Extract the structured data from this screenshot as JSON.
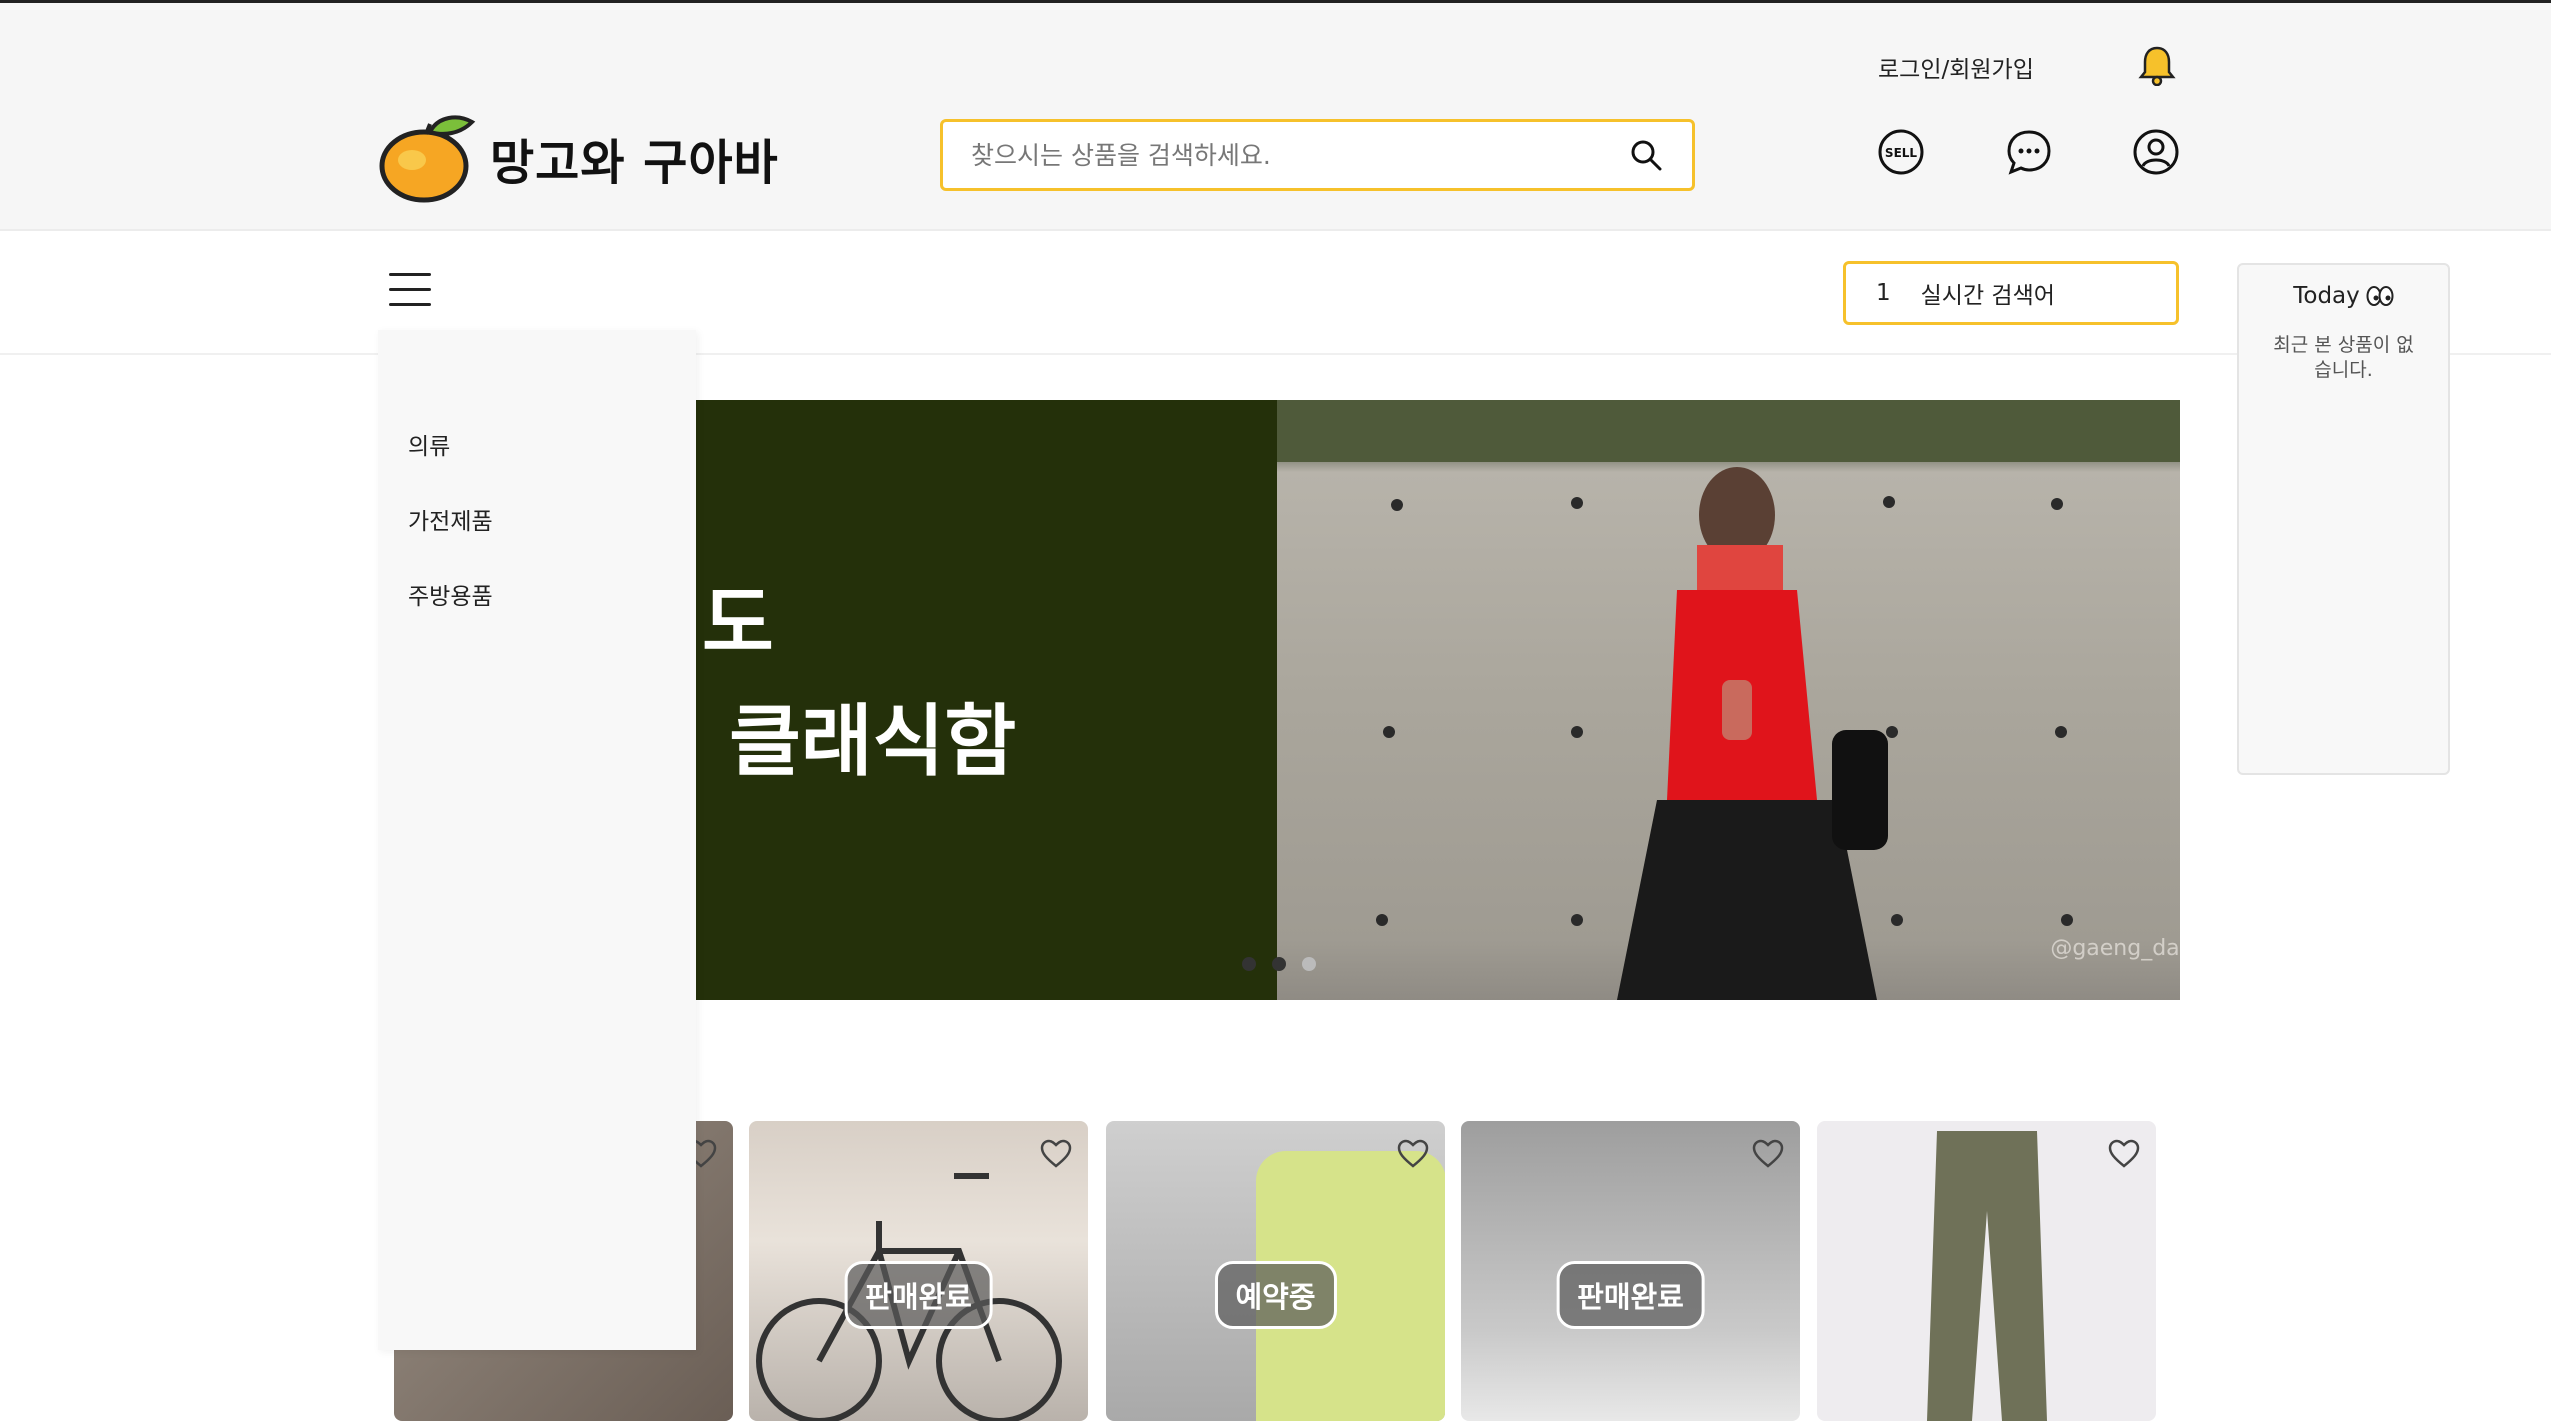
{
  "header": {
    "logo_text": "망고와 구아바",
    "search_placeholder": "찾으시는 상품을 검색하세요.",
    "login_label": "로그인/회원가입",
    "icons": [
      "mango-icon",
      "search-icon",
      "bell-icon",
      "sell-icon",
      "chat-icon",
      "user-icon"
    ],
    "sell_icon_label": "SELL"
  },
  "nav": {
    "realtime_rank": "1",
    "realtime_label": "실시간 검색어"
  },
  "today": {
    "title": "Today",
    "empty_text": "최근 본 상품이 없습니다."
  },
  "side_menu": {
    "items": [
      "의류",
      "가전제품",
      "주방용품"
    ]
  },
  "banner": {
    "title_lines": "도\n 클래식함",
    "watermark": "@gaeng_da",
    "slide_count": 3
  },
  "products": [
    {
      "status": ""
    },
    {
      "status": "판매완료"
    },
    {
      "status": "예약중"
    },
    {
      "status": "판매완료"
    },
    {
      "status": ""
    }
  ],
  "colors": {
    "accent": "#f6c12b",
    "banner_bg": "#24300a",
    "header_bg": "#f6f6f6"
  }
}
